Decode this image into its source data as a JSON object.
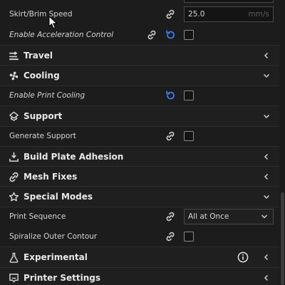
{
  "settings_panel": {
    "skirt_brim_speed": {
      "label": "Skirt/Brim Speed",
      "value": "25.0",
      "unit": "mm/s"
    },
    "enable_acceleration_control": {
      "label": "Enable Acceleration Control",
      "checked": false
    },
    "travel": {
      "title": "Travel",
      "expanded": false
    },
    "cooling": {
      "title": "Cooling",
      "expanded": true
    },
    "enable_print_cooling": {
      "label": "Enable Print Cooling",
      "checked": false
    },
    "support": {
      "title": "Support",
      "expanded": true
    },
    "generate_support": {
      "label": "Generate Support",
      "checked": false
    },
    "build_plate_adhesion": {
      "title": "Build Plate Adhesion",
      "expanded": false
    },
    "mesh_fixes": {
      "title": "Mesh Fixes",
      "expanded": false
    },
    "special_modes": {
      "title": "Special Modes",
      "expanded": true
    },
    "print_sequence": {
      "label": "Print Sequence",
      "value": "All at Once"
    },
    "spiralize_outer_contour": {
      "label": "Spiralize Outer Contour",
      "checked": false
    },
    "experimental": {
      "title": "Experimental",
      "expanded": false,
      "info_icon": "info-icon"
    },
    "printer_settings": {
      "title": "Printer Settings",
      "expanded": false
    }
  },
  "colors": {
    "background": "#1c1c1c",
    "section_background": "#1f1f1f",
    "reset_icon": "#3b82f6",
    "text": "#d6d6d6"
  }
}
